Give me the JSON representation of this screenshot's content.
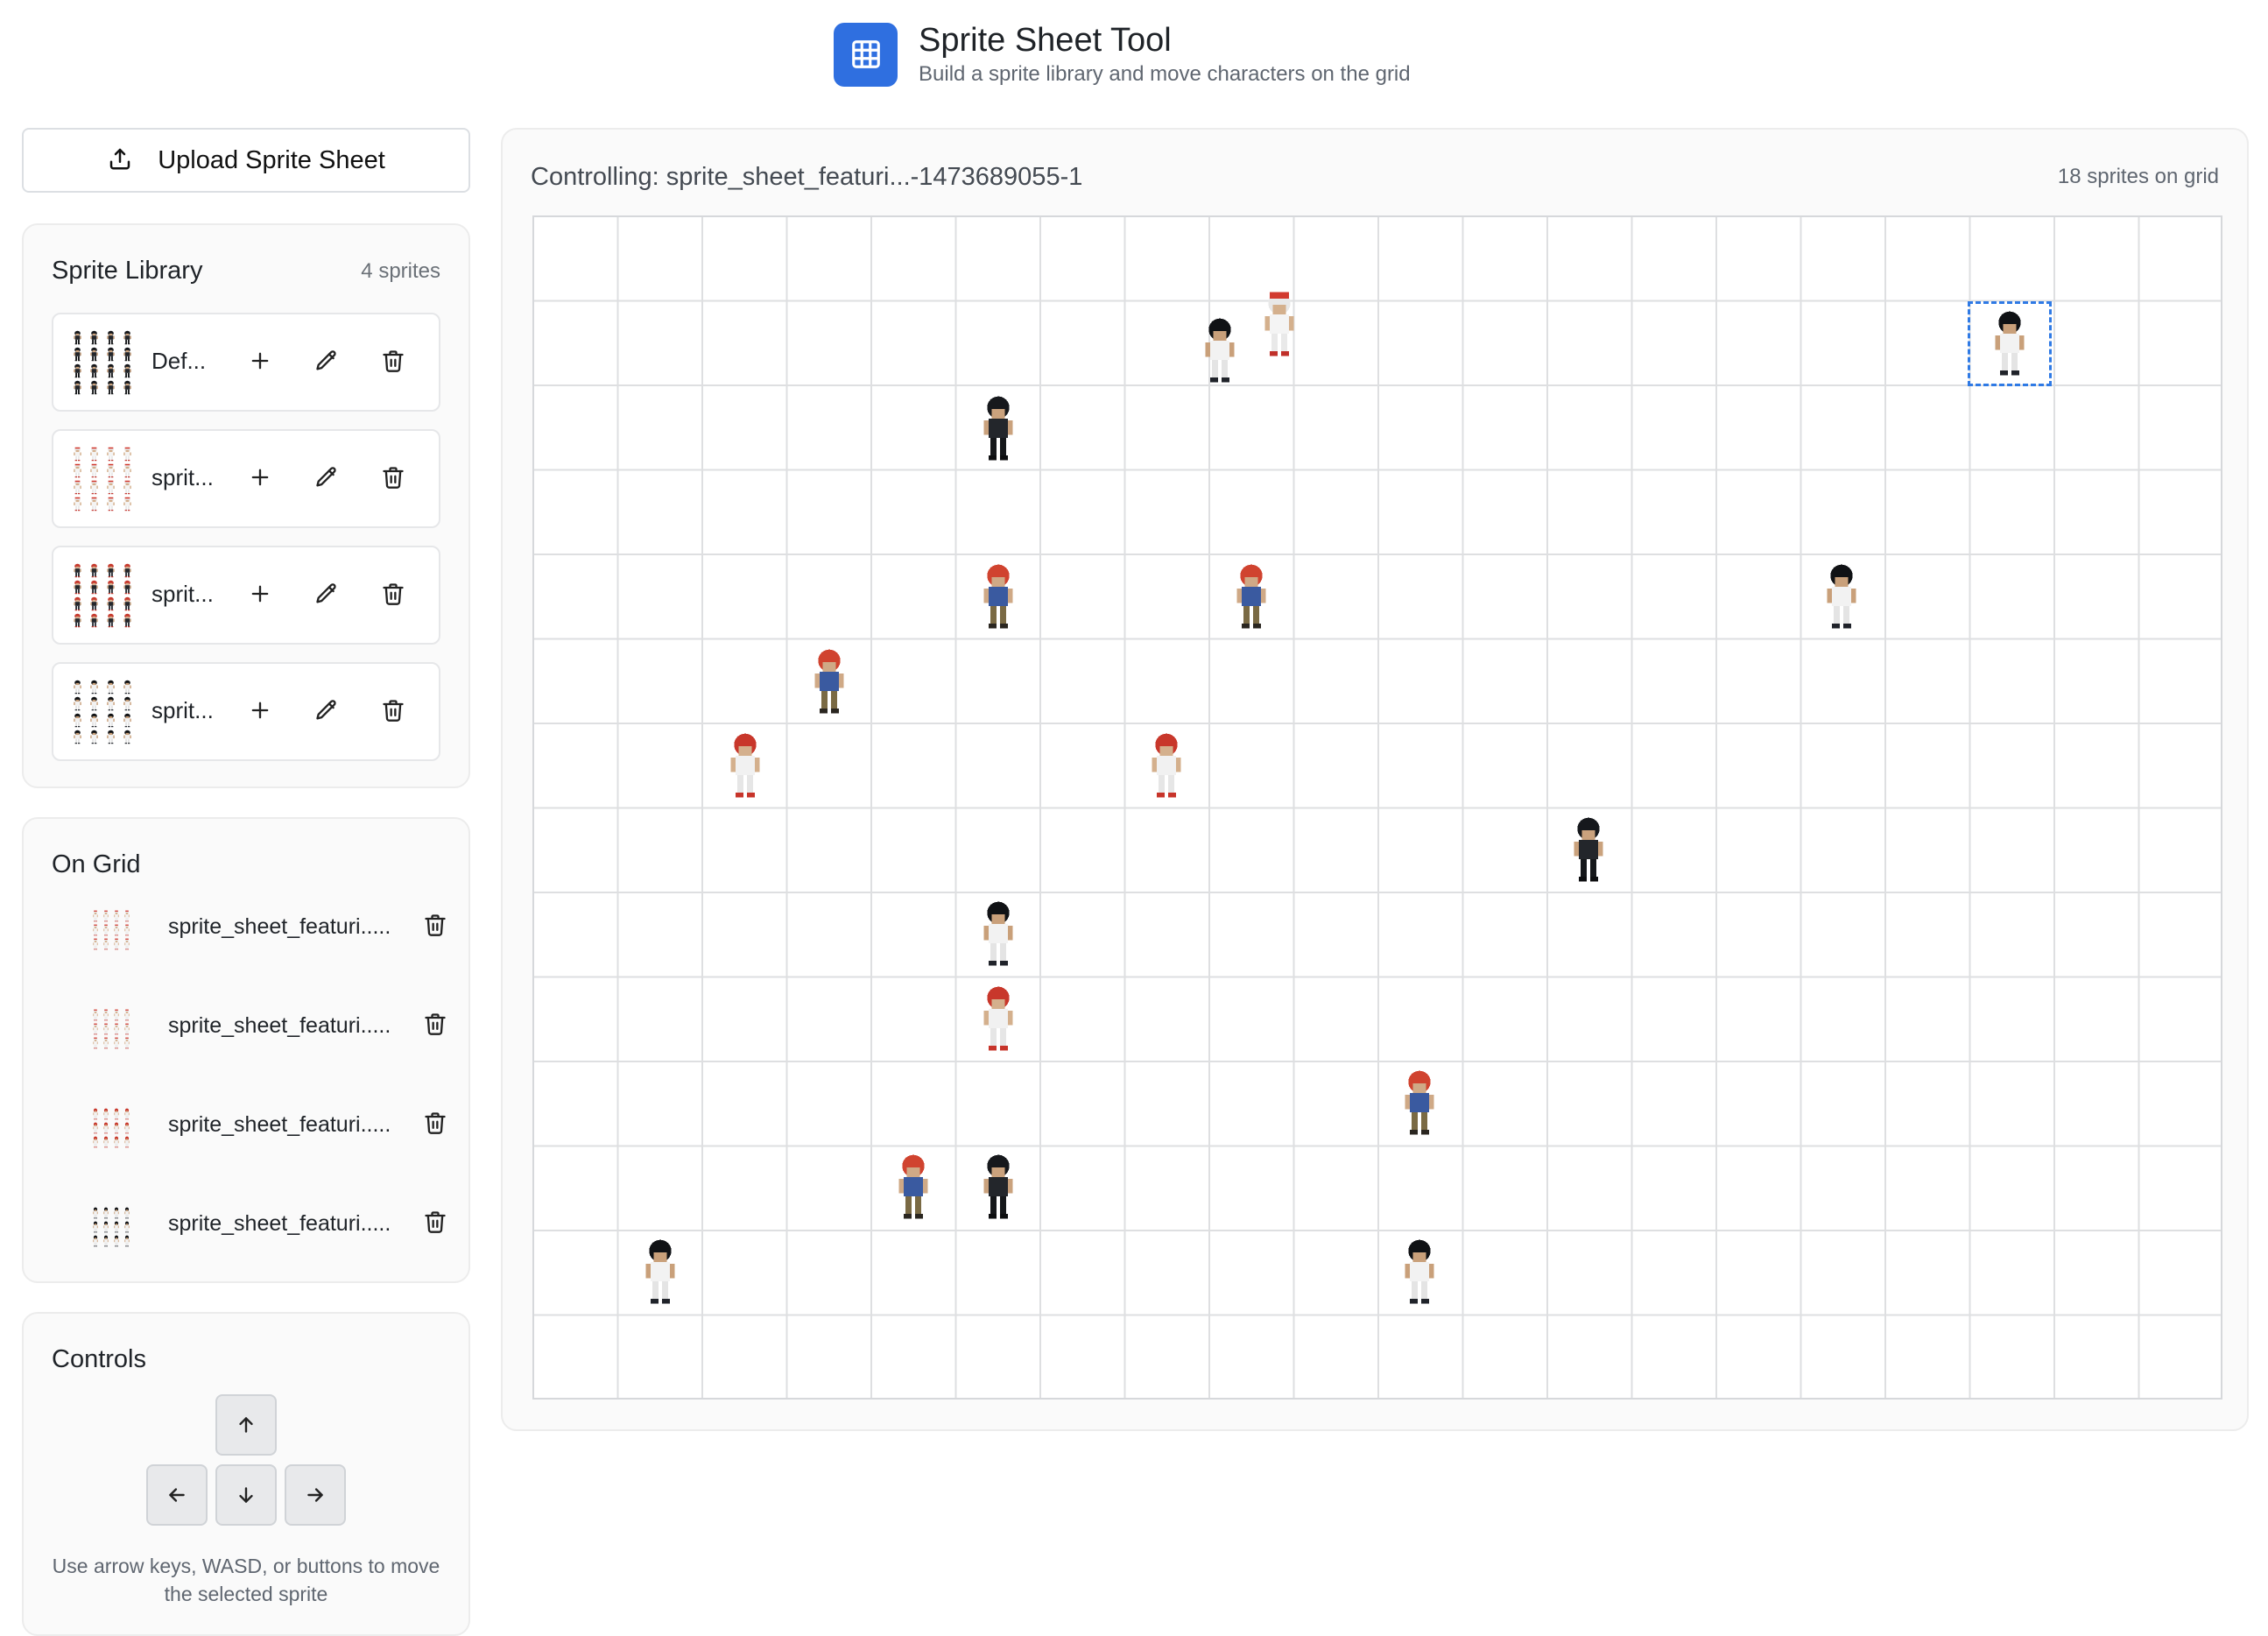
{
  "header": {
    "title": "Sprite Sheet Tool",
    "subtitle": "Build a sprite library and move characters on the grid",
    "logo_icon": "grid-icon",
    "accent_color": "#2f6fe0"
  },
  "sidebar": {
    "upload_label": "Upload Sprite Sheet",
    "library": {
      "title": "Sprite Library",
      "count": "4 sprites",
      "items": [
        {
          "name": "Def...",
          "palette": "dark"
        },
        {
          "name": "sprit...",
          "palette": "white-red"
        },
        {
          "name": "sprit...",
          "palette": "red"
        },
        {
          "name": "sprit...",
          "palette": "dark-white"
        }
      ]
    },
    "on_grid": {
      "title": "On Grid",
      "items": [
        {
          "name": "sprite_sheet_featuri....."
        },
        {
          "name": "sprite_sheet_featuri....."
        },
        {
          "name": "sprite_sheet_featuri....."
        },
        {
          "name": "sprite_sheet_featuri....."
        }
      ]
    },
    "controls": {
      "title": "Controls",
      "hint": "Use arrow keys, WASD, or buttons to move the selected sprite"
    }
  },
  "main": {
    "controlling": "Controlling: sprite_sheet_featuri...-1473689055-1",
    "sprite_count": "18 sprites on grid",
    "grid_columns": 20,
    "grid_rows": 14,
    "selected_cell": {
      "col": 17,
      "row": 1
    },
    "sprites": [
      {
        "col": 8,
        "row": 1,
        "type": "dark-white"
      },
      {
        "col": 8,
        "row": 1,
        "type": "white-red"
      },
      {
        "col": 17,
        "row": 1,
        "type": "dark-white"
      },
      {
        "col": 5,
        "row": 2,
        "type": "dark"
      },
      {
        "col": 5,
        "row": 4,
        "type": "red-blue"
      },
      {
        "col": 8,
        "row": 4,
        "type": "red-blue"
      },
      {
        "col": 15,
        "row": 4,
        "type": "dark-white"
      },
      {
        "col": 2,
        "row": 6,
        "type": "red-white"
      },
      {
        "col": 3,
        "row": 5,
        "type": "red-blue"
      },
      {
        "col": 7,
        "row": 6,
        "type": "red-white"
      },
      {
        "col": 12,
        "row": 7,
        "type": "dark"
      },
      {
        "col": 5,
        "row": 8,
        "type": "dark-white"
      },
      {
        "col": 5,
        "row": 9,
        "type": "red-white"
      },
      {
        "col": 10,
        "row": 10,
        "type": "red-blue"
      },
      {
        "col": 4,
        "row": 11,
        "type": "red-blue"
      },
      {
        "col": 5,
        "row": 11,
        "type": "dark"
      },
      {
        "col": 1,
        "row": 12,
        "type": "dark-white"
      },
      {
        "col": 10,
        "row": 12,
        "type": "dark-white"
      }
    ]
  }
}
